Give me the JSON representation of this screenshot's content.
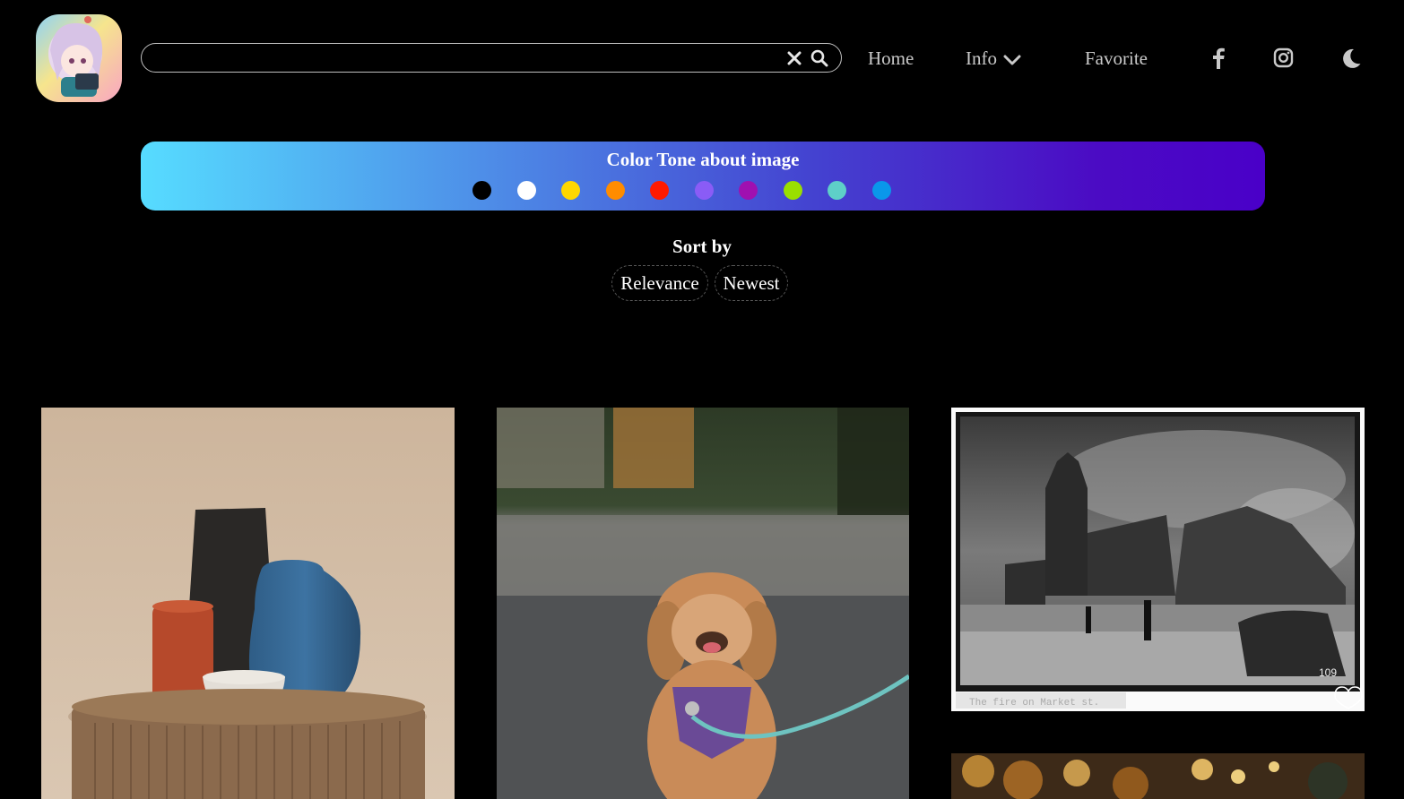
{
  "header": {
    "logo_icon": "anime-avatar-logo",
    "search": {
      "value": "",
      "placeholder": ""
    },
    "nav": {
      "home": "Home",
      "info": "Info",
      "favorite": "Favorite"
    },
    "icons": [
      "clear-icon",
      "search-icon",
      "chevron-down-icon",
      "facebook-icon",
      "instagram-icon",
      "moon-icon"
    ]
  },
  "color_tone": {
    "title": "Color Tone about image",
    "colors": [
      "#000000",
      "#ffffff",
      "#ffd700",
      "#ff8c00",
      "#ff1a00",
      "#8a5cf6",
      "#a010b0",
      "#9adf00",
      "#5ecfc8",
      "#0a97ea"
    ]
  },
  "sort": {
    "title": "Sort by",
    "options": [
      "Relevance",
      "Newest"
    ]
  },
  "gallery": {
    "images": [
      "vases-on-pedestal",
      "poodle-on-leash",
      "city-fire-photo",
      "bokeh-lights"
    ],
    "fire_caption": "The fire on Market st."
  }
}
